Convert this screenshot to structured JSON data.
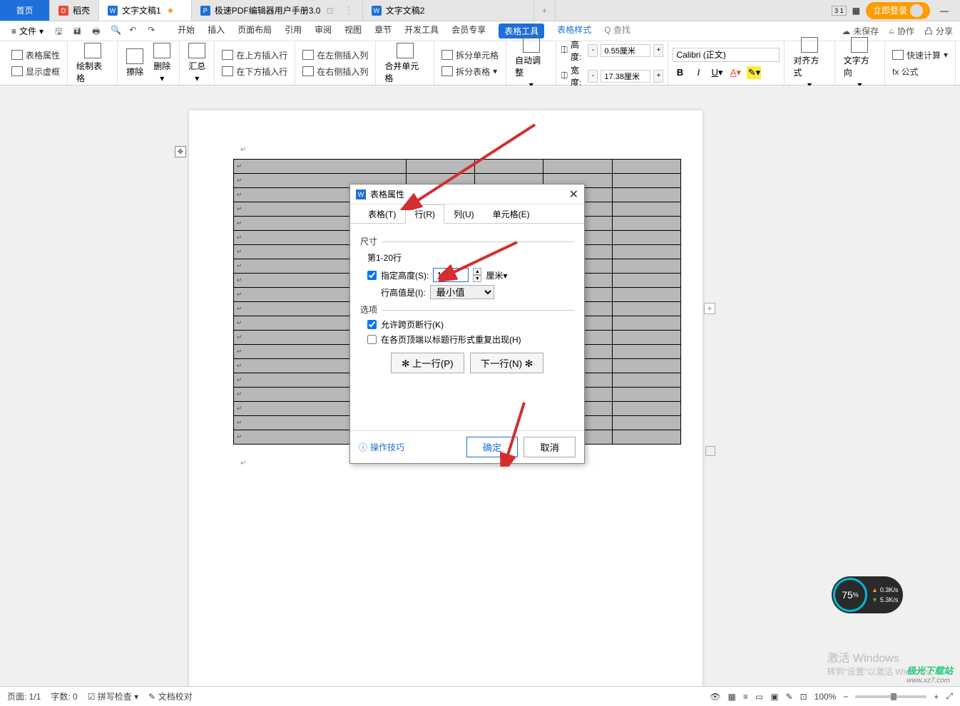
{
  "tabs": {
    "home": "首页",
    "docker": "稻壳",
    "doc1": "文字文稿1",
    "pdf": "极速PDF编辑器用户手册3.0",
    "doc2": "文字文稿2",
    "login": "立即登录"
  },
  "menu": {
    "file": "文件",
    "items": [
      "开始",
      "插入",
      "页面布局",
      "引用",
      "审阅",
      "视图",
      "章节",
      "开发工具",
      "会员专享"
    ],
    "table_tools": "表格工具",
    "table_style": "表格样式",
    "search": "Q 查找",
    "unsaved": "未保存",
    "coop": "协作",
    "share": "分享"
  },
  "ribbon": {
    "show_attr": "表格属性",
    "show_frame": "显示虚框",
    "draw": "绘制表格",
    "erase": "擦除",
    "delete": "删除",
    "summary": "汇总",
    "ins_above": "在上方插入行",
    "ins_below": "在下方插入行",
    "ins_left": "在左侧插入列",
    "ins_right": "在右侧插入列",
    "merge": "合并单元格",
    "split_cell": "拆分单元格",
    "split_table": "拆分表格",
    "auto_adjust": "自动调整",
    "height_lbl": "高度:",
    "height_val": "0.55厘米",
    "width_lbl": "宽度:",
    "width_val": "17.38厘米",
    "font": "Calibri (正文)",
    "align": "对齐方式",
    "text_dir": "文字方向",
    "fast_calc": "快速计算",
    "formula": "fx 公式"
  },
  "dialog": {
    "title": "表格属性",
    "tabs": {
      "table": "表格(T)",
      "row": "行(R)",
      "col": "列(U)",
      "cell": "单元格(E)"
    },
    "size": "尺寸",
    "rows_label": "第1-20行",
    "spec_height": "指定高度(S):",
    "height_val": "1.2",
    "unit": "厘米",
    "row_height_is": "行高值是(I):",
    "min_val": "最小值",
    "options": "选项",
    "allow_break": "允许跨页断行(K)",
    "repeat_header": "在各页顶端以标题行形式重复出现(H)",
    "prev": "上一行(P)",
    "next": "下一行(N)",
    "tips": "操作技巧",
    "ok": "确定",
    "cancel": "取消"
  },
  "status": {
    "page": "页面: 1/1",
    "words": "字数: 0",
    "spell": "拼写检查",
    "proof": "文档校对",
    "zoom": "100%"
  },
  "watermark": {
    "title": "激活 Windows",
    "sub": "转到\"设置\"以激活 Windows。"
  },
  "speed": {
    "pct": "75",
    "unit": "%",
    "up": "0.3K/s",
    "down": "5.3K/s"
  },
  "site": {
    "name": "极光下载站",
    "url": "www.xz7.com"
  }
}
